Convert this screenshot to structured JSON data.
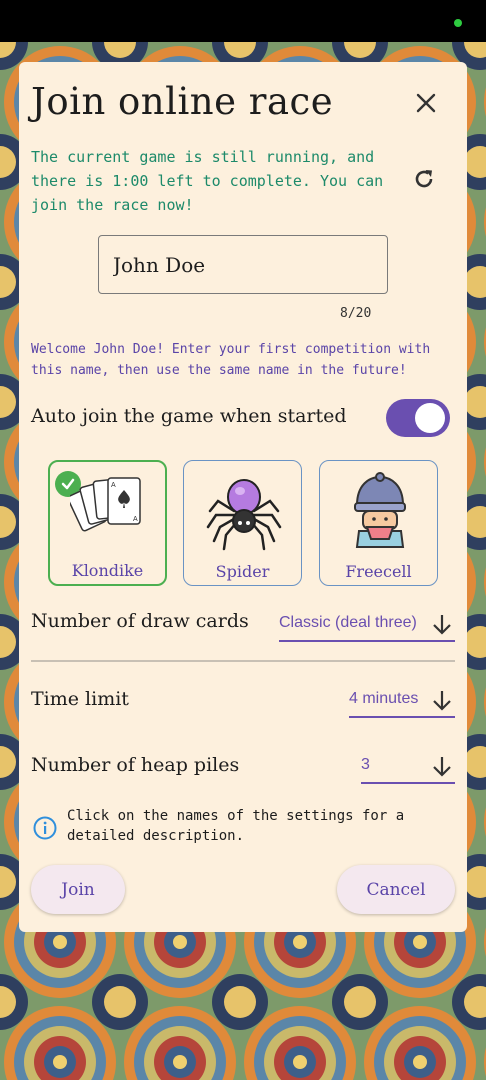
{
  "dialog": {
    "title": "Join online race",
    "running_info": "The current game is still running, and there is 1:00 left to complete. You can join the race now!",
    "name_value": "John Doe",
    "char_count": "8/20",
    "welcome": "Welcome John Doe! Enter your first competition with this name, then use the same name in the future!",
    "auto_join_label": "Auto join the game when started",
    "auto_join_on": true,
    "games": [
      {
        "label": "Klondike",
        "selected": true
      },
      {
        "label": "Spider",
        "selected": false
      },
      {
        "label": "Freecell",
        "selected": false
      }
    ],
    "settings": {
      "draw_cards_label": "Number of draw cards",
      "draw_cards_value": "Classic (deal three)",
      "time_limit_label": "Time limit",
      "time_limit_value": "4 minutes",
      "heap_piles_label": "Number of heap piles",
      "heap_piles_value": "3"
    },
    "hint": "Click on the names of the settings for a detailed description.",
    "join_label": "Join",
    "cancel_label": "Cancel"
  },
  "colors": {
    "accent": "#6a4fb0",
    "running_text": "#1d8a6a",
    "selected_border": "#4caf50",
    "dialog_bg": "#fdf0dd"
  },
  "icons": [
    "close-icon",
    "refresh-icon",
    "check-icon",
    "cards-icon",
    "spider-icon",
    "gnome-icon",
    "arrow-down-icon",
    "info-icon"
  ]
}
